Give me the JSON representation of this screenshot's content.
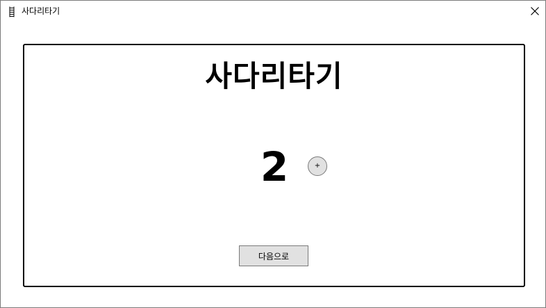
{
  "window": {
    "title": "사다리타기",
    "icon": "ladder-icon",
    "close_icon": "close-icon"
  },
  "main": {
    "title": "사다리타기",
    "count": "2",
    "increment_label": "+",
    "next_label": "다음으로"
  },
  "colors": {
    "background": "#ffffff",
    "panel_border": "#000000",
    "button_face": "#e1e1e1",
    "button_border": "#7a7a7a"
  }
}
